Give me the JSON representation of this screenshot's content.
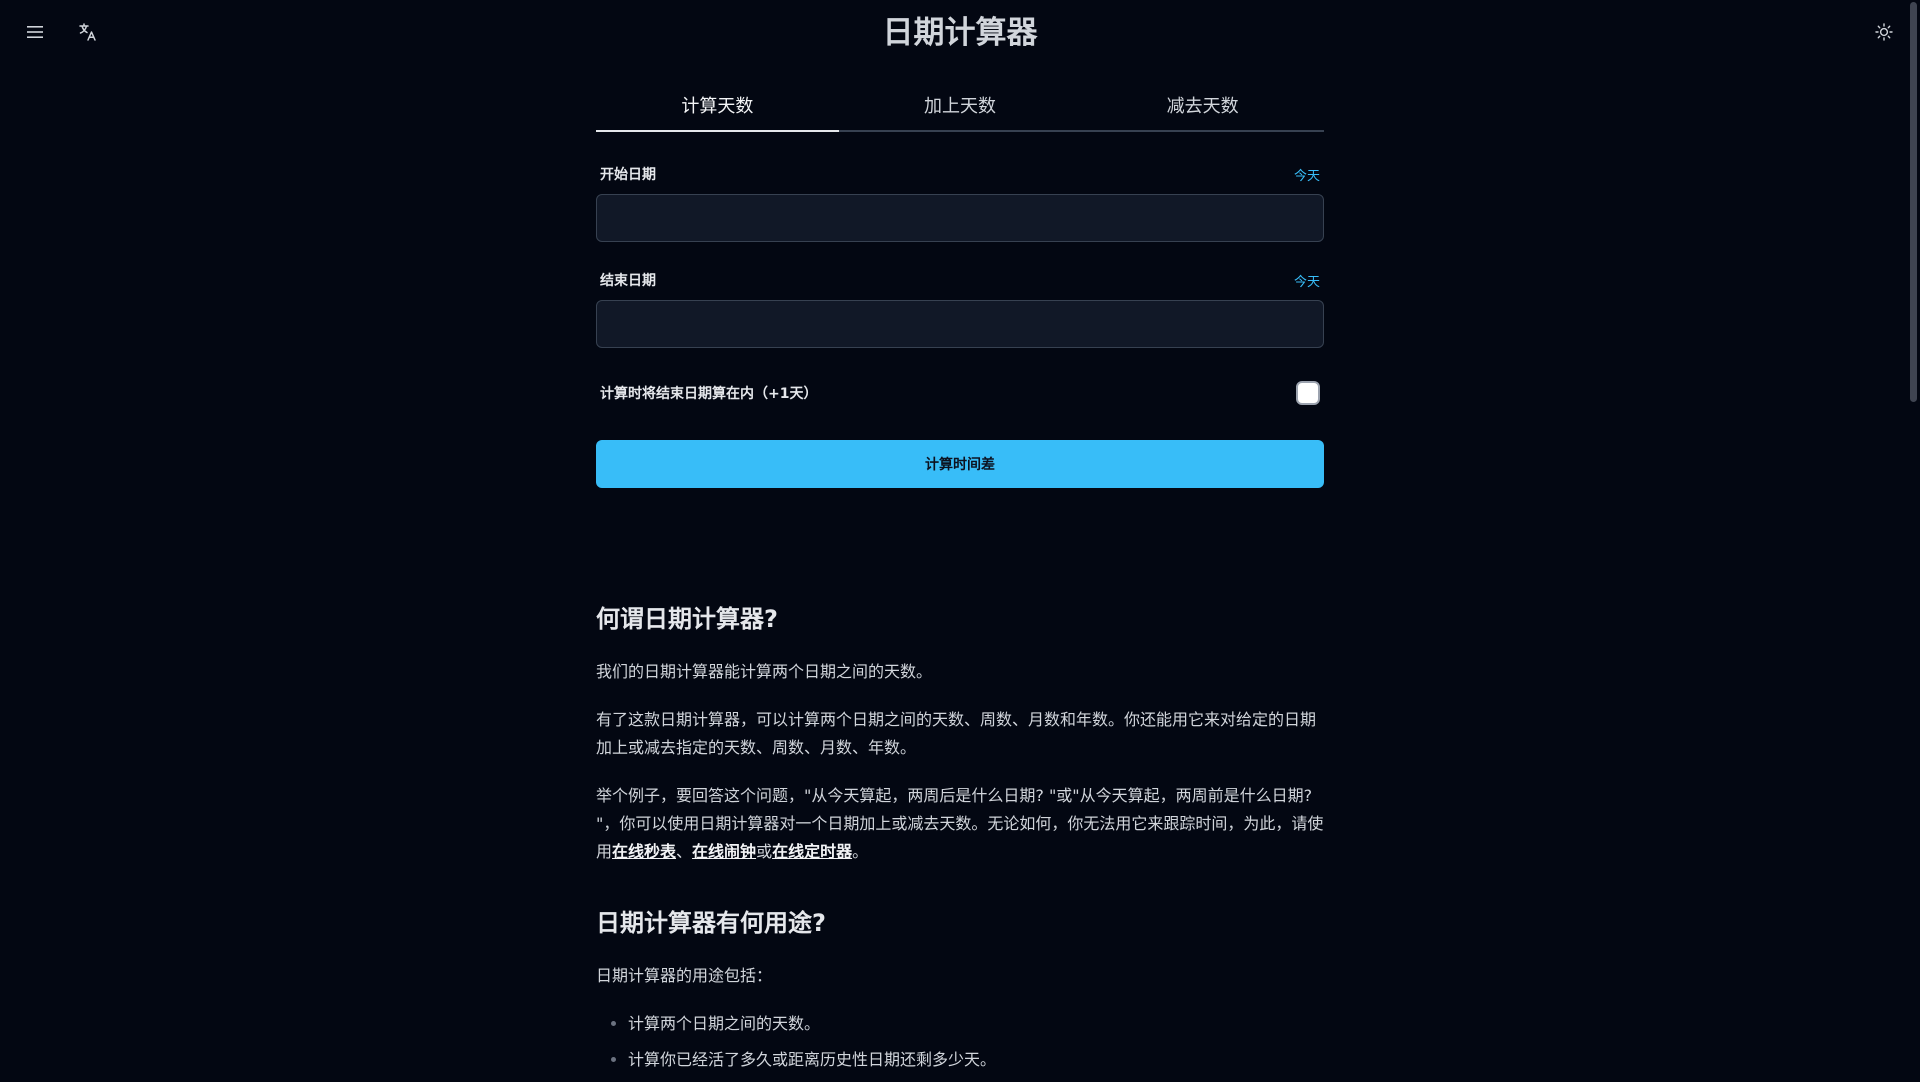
{
  "header": {
    "title": "日期计算器",
    "menu_icon": "menu-icon",
    "language_icon": "translate-icon",
    "theme_icon": "sun-icon"
  },
  "tabs": [
    {
      "label": "计算天数",
      "active": true
    },
    {
      "label": "加上天数",
      "active": false
    },
    {
      "label": "减去天数",
      "active": false
    }
  ],
  "form": {
    "start": {
      "label": "开始日期",
      "today": "今天",
      "value": ""
    },
    "end": {
      "label": "结束日期",
      "today": "今天",
      "value": ""
    },
    "include_end": {
      "label": "计算时将结束日期算在内（+1天）",
      "checked": false
    },
    "submit_label": "计算时间差"
  },
  "article": {
    "h1": "何谓日期计算器?",
    "p1": "我们的日期计算器能计算两个日期之间的天数。",
    "p2": "有了这款日期计算器，可以计算两个日期之间的天数、周数、月数和年数。你还能用它来对给定的日期加上或减去指定的天数、周数、月数、年数。",
    "p3_text": "举个例子，要回答这个问题，\"从今天算起，两周后是什么日期? \"或\"从今天算起，两周前是什么日期? \"，你可以使用日期计算器对一个日期加上或减去天数。无论如何，你无法用它来跟踪时间，为此，请使用",
    "p3_link1": "在线秒表",
    "p3_sep1": "、",
    "p3_link2": "在线闹钟",
    "p3_sep2": "或",
    "p3_link3": "在线定时器",
    "p3_end": "。",
    "h2": "日期计算器有何用途?",
    "p4": "日期计算器的用途包括：",
    "list": [
      "计算两个日期之间的天数。",
      "计算你已经活了多久或距离历史性日期还剩多少天。"
    ]
  },
  "colors": {
    "background": "#030712",
    "accent": "#38bdf8",
    "input_bg": "#111827"
  }
}
